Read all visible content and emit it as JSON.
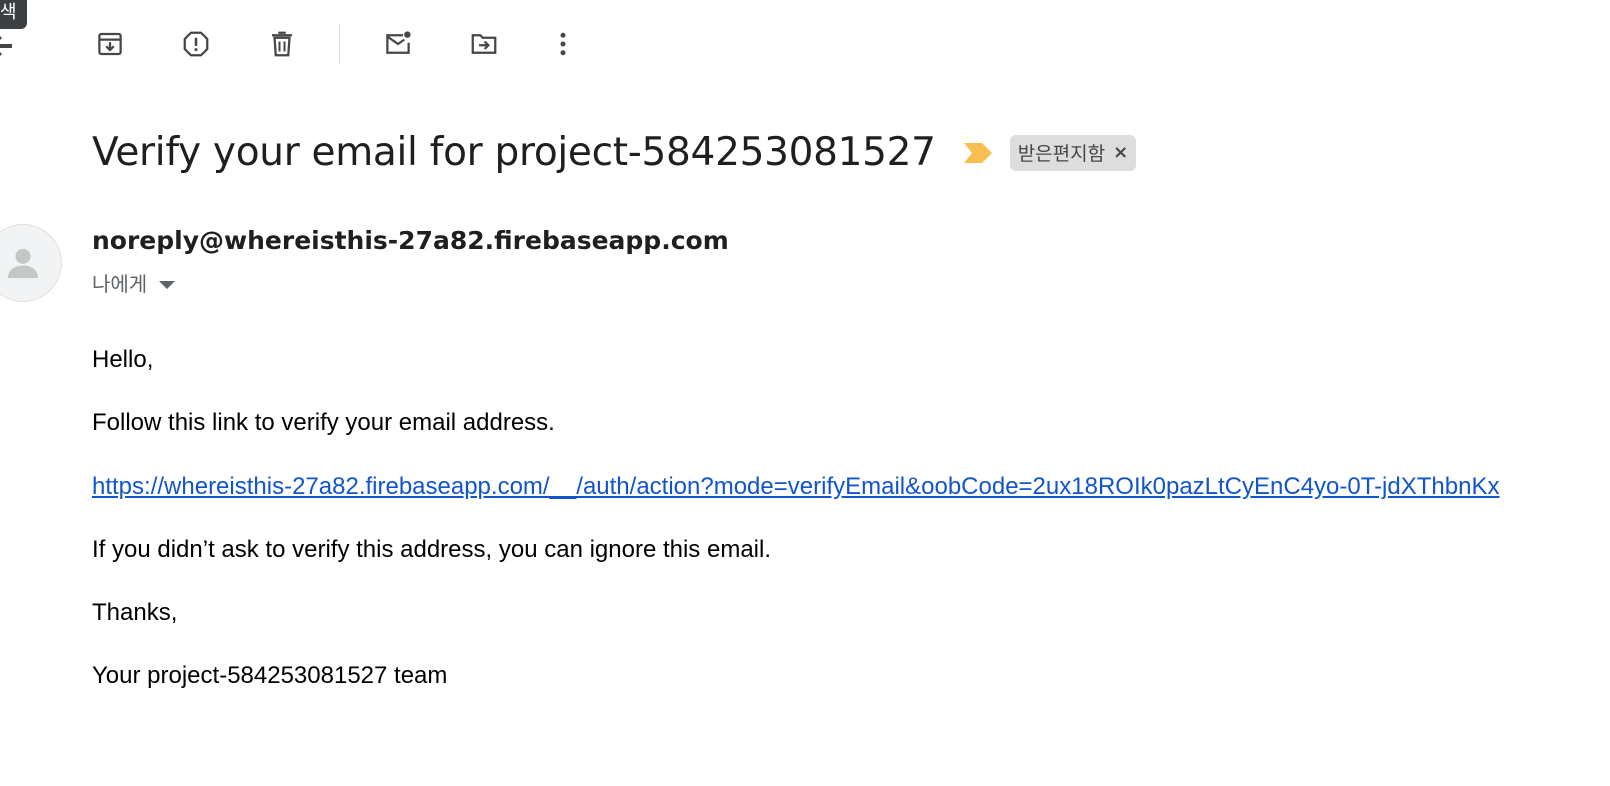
{
  "tooltip": {
    "text": "색"
  },
  "toolbar": {
    "archive_icon": "archive-icon",
    "report_spam_icon": "report-spam-icon",
    "delete_icon": "delete-icon",
    "mark_unread_icon": "mark-unread-icon",
    "move_to_icon": "move-to-icon",
    "more_icon": "more-vert-icon"
  },
  "email": {
    "subject": "Verify your email for project-584253081527",
    "label": "받은편지함",
    "label_remove": "×",
    "sender": "noreply@whereisthis-27a82.firebaseapp.com",
    "recipient": "나에게",
    "body": {
      "greeting": "Hello,",
      "line1": "Follow this link to verify your email address.",
      "link": "https://whereisthis-27a82.firebaseapp.com/__/auth/action?mode=verifyEmail&oobCode=2ux18ROIk0pazLtCyEnC4yo-0T-jdXThbnKx",
      "line2": "If you didn’t ask to verify this address, you can ignore this email.",
      "thanks": "Thanks,",
      "signature": "Your project-584253081527 team"
    }
  },
  "colors": {
    "importance_marker": "#f6bf4f",
    "link": "#1155cc",
    "label_chip_bg": "#dddddd"
  }
}
